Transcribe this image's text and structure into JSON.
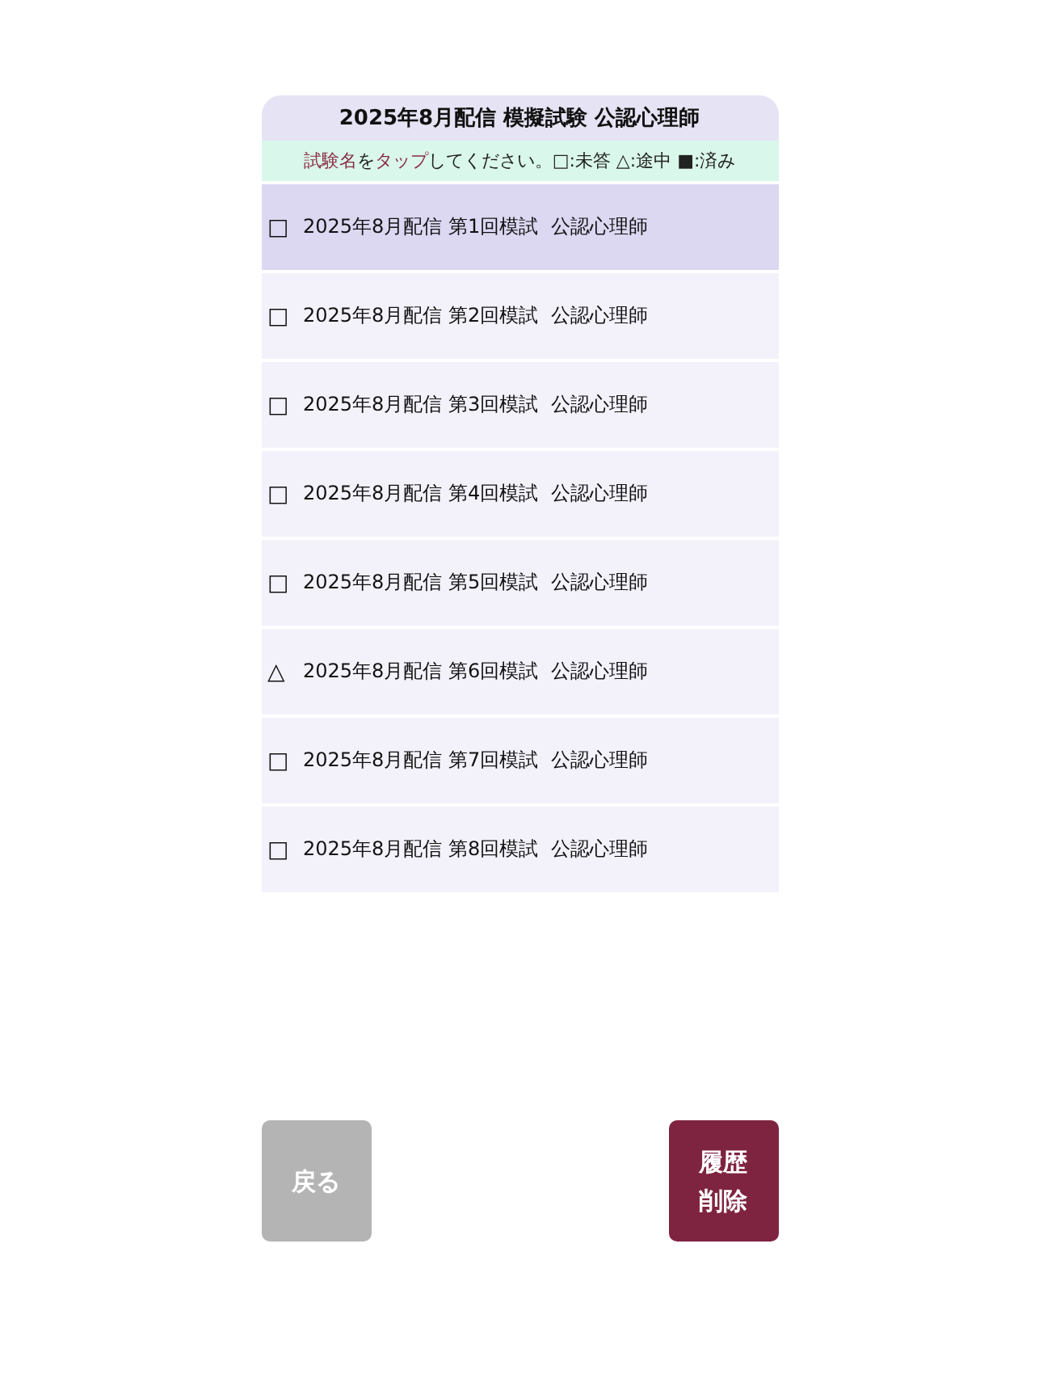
{
  "header": {
    "title": "2025年8月配信 模擬試験 公認心理師"
  },
  "hint": {
    "segments": [
      {
        "text": "試験名",
        "kind": "accent"
      },
      {
        "text": "を",
        "kind": "plain"
      },
      {
        "text": "タップ",
        "kind": "accent"
      },
      {
        "text": "してください。□:未答 △:途中 ■:済み",
        "kind": "plain"
      }
    ]
  },
  "exams": [
    {
      "mark": "□",
      "title": "2025年8月配信 第1回模試  公認心理師",
      "selected": true
    },
    {
      "mark": "□",
      "title": "2025年8月配信 第2回模試  公認心理師",
      "selected": false
    },
    {
      "mark": "□",
      "title": "2025年8月配信 第3回模試  公認心理師",
      "selected": false
    },
    {
      "mark": "□",
      "title": "2025年8月配信 第4回模試  公認心理師",
      "selected": false
    },
    {
      "mark": "□",
      "title": "2025年8月配信 第5回模試  公認心理師",
      "selected": false
    },
    {
      "mark": "△",
      "title": "2025年8月配信 第6回模試  公認心理師",
      "selected": false
    },
    {
      "mark": "□",
      "title": "2025年8月配信 第7回模試  公認心理師",
      "selected": false
    },
    {
      "mark": "□",
      "title": "2025年8月配信 第8回模試  公認心理師",
      "selected": false
    }
  ],
  "buttons": {
    "back": {
      "label": "戻る",
      "disabled": true
    },
    "delete": {
      "label": "履歴削除",
      "disabled": false
    }
  }
}
